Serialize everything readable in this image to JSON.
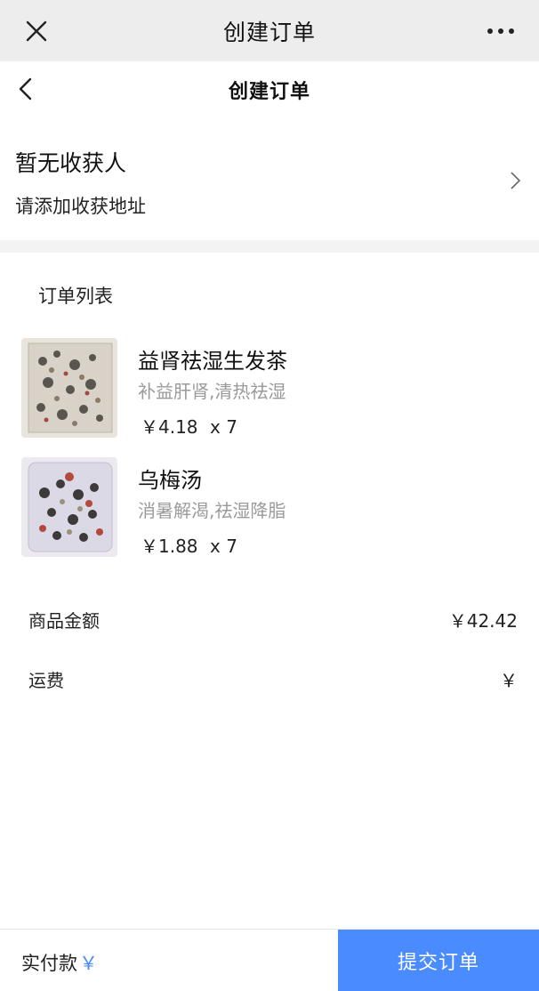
{
  "wx": {
    "title": "创建订单"
  },
  "nav": {
    "title": "创建订单"
  },
  "address": {
    "name": "暂无收获人",
    "hint": "请添加收获地址"
  },
  "order_list": {
    "title": "订单列表",
    "items": [
      {
        "name": "益肾祛湿生发茶",
        "desc": "补益肝肾,清热祛湿",
        "price": "￥4.18",
        "qty": "x 7"
      },
      {
        "name": "乌梅汤",
        "desc": "消暑解渴,祛湿降脂",
        "price": "￥1.88",
        "qty": "x 7"
      }
    ]
  },
  "summary": {
    "goods_label": "商品金额",
    "goods_value": "￥42.42",
    "freight_label": "运费",
    "freight_value": "￥"
  },
  "bottom": {
    "pay_label": "实付款",
    "pay_yen": "￥",
    "submit_label": "提交订单"
  },
  "colors": {
    "accent": "#4a8cff",
    "topbar": "#ededed",
    "muted": "#9a9a9a"
  }
}
